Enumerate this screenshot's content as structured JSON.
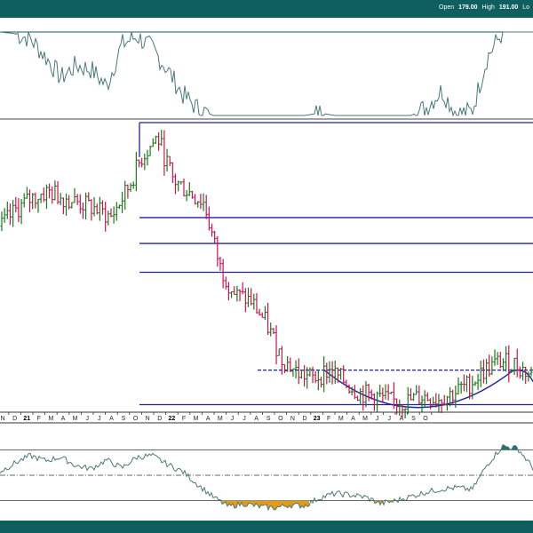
{
  "header": {
    "items": [
      {
        "label": "Open",
        "value": "179.00"
      },
      {
        "label": "High",
        "value": "191.00"
      },
      {
        "label": "Lo",
        "value": ""
      }
    ]
  },
  "colors": {
    "frame": "#0f5f5f",
    "up_bar": "#1a7a1a",
    "down_bar": "#d01050",
    "indicator_line": "#4a7878",
    "level_line": "#2020a0",
    "bottom_fill": "#e39a1a",
    "top_fill": "#2a6e6e"
  },
  "chart_data": [
    {
      "type": "line",
      "panel": "top-indicator",
      "x": [
        "2020-11",
        "2020-12",
        "2021-01",
        "2021-02",
        "2021-03",
        "2021-04",
        "2021-05",
        "2021-06",
        "2021-07",
        "2021-08",
        "2021-09",
        "2021-10",
        "2021-11",
        "2021-12",
        "2022-01",
        "2022-02",
        "2022-03",
        "2022-04",
        "2022-05",
        "2022-06",
        "2022-07",
        "2022-08",
        "2022-09",
        "2022-10",
        "2022-11",
        "2022-12",
        "2023-01",
        "2023-02",
        "2023-03",
        "2023-04",
        "2023-05",
        "2023-06",
        "2023-07",
        "2023-08",
        "2023-09",
        "2023-10"
      ],
      "series": [
        {
          "values": [
            100,
            98,
            92,
            70,
            45,
            60,
            55,
            35,
            85,
            95,
            80,
            55,
            25,
            8,
            0,
            0,
            0,
            0,
            0,
            0,
            0,
            3,
            0,
            0,
            0,
            0,
            0,
            0,
            10,
            30,
            2,
            5,
            70,
            100,
            100,
            100
          ]
        }
      ],
      "ylim": [
        0,
        100
      ],
      "guides": [
        100
      ]
    },
    {
      "type": "bar",
      "panel": "price",
      "bar_style": "ohlc",
      "x": [
        "2020-12",
        "2021-01",
        "2021-02",
        "2021-03",
        "2021-04",
        "2021-05",
        "2021-06",
        "2021-07",
        "2021-08",
        "2021-09",
        "2021-10",
        "2021-11",
        "2021-12",
        "2022-01",
        "2022-02",
        "2022-03",
        "2022-04",
        "2022-05",
        "2022-06",
        "2022-07",
        "2022-08",
        "2022-09",
        "2022-10",
        "2022-11",
        "2022-12",
        "2023-01",
        "2023-02",
        "2023-03",
        "2023-04",
        "2023-05",
        "2023-06",
        "2023-07",
        "2023-08",
        "2023-09",
        "2023-10"
      ],
      "values": [
        64,
        70,
        74,
        76,
        74,
        72,
        70,
        67,
        76,
        88,
        95,
        80,
        76,
        72,
        50,
        40,
        38,
        30,
        18,
        13,
        11,
        14,
        10,
        6,
        5,
        3,
        3,
        5,
        4,
        6,
        9,
        14,
        17,
        16,
        12
      ],
      "ylim": [
        0,
        100
      ],
      "levels": [
        100,
        67,
        58,
        48
      ],
      "resistance": 14,
      "support": 2,
      "x_ticks": [
        "N",
        "D",
        "21",
        "F",
        "M",
        "A",
        "M",
        "J",
        "J",
        "A",
        "S",
        "O",
        "N",
        "D",
        "22",
        "F",
        "M",
        "A",
        "M",
        "J",
        "J",
        "A",
        "S",
        "O",
        "N",
        "D",
        "23",
        "F",
        "M",
        "A",
        "M",
        "J",
        "J",
        "A",
        "S",
        "O"
      ]
    },
    {
      "type": "line",
      "panel": "bottom-indicator",
      "x": [
        "2020-11",
        "2020-12",
        "2021-01",
        "2021-02",
        "2021-03",
        "2021-04",
        "2021-05",
        "2021-06",
        "2021-07",
        "2021-08",
        "2021-09",
        "2021-10",
        "2021-11",
        "2021-12",
        "2022-01",
        "2022-02",
        "2022-03",
        "2022-04",
        "2022-05",
        "2022-06",
        "2022-07",
        "2022-08",
        "2022-09",
        "2022-10",
        "2022-11",
        "2022-12",
        "2023-01",
        "2023-02",
        "2023-03",
        "2023-04",
        "2023-05",
        "2023-06",
        "2023-07",
        "2023-08",
        "2023-09",
        "2023-10"
      ],
      "series": [
        {
          "values": [
            40,
            52,
            62,
            55,
            60,
            48,
            44,
            56,
            45,
            60,
            62,
            50,
            40,
            22,
            5,
            -8,
            -4,
            -8,
            -10,
            -6,
            -7,
            4,
            10,
            8,
            5,
            -4,
            0,
            6,
            12,
            16,
            18,
            15,
            50,
            75,
            72,
            45
          ]
        }
      ],
      "ylim": [
        -20,
        90
      ],
      "guides": [
        70,
        35,
        0
      ]
    }
  ]
}
